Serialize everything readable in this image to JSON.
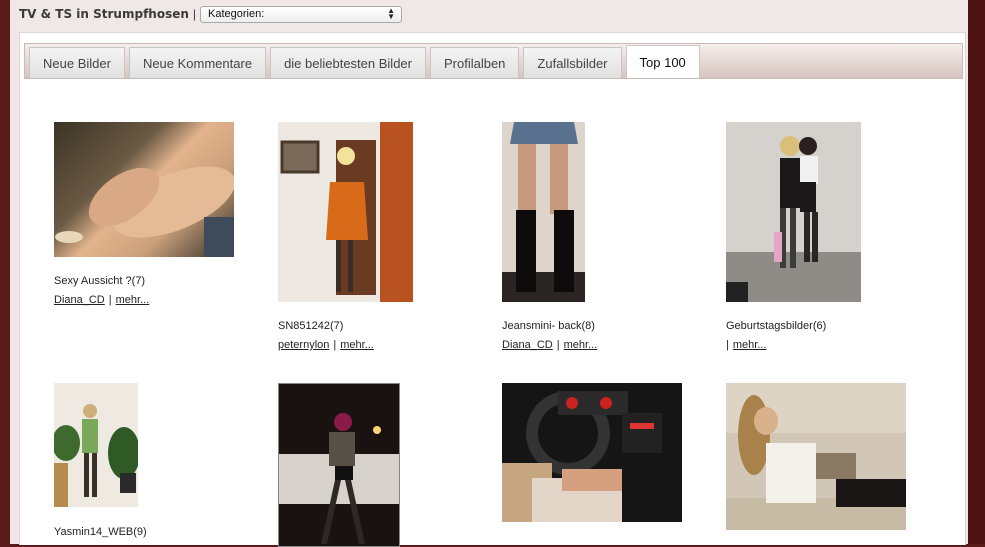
{
  "header": {
    "site_title": "TV & TS in Strumpfhosen",
    "separator": "|",
    "category_select": "Kategorien:"
  },
  "tabs": [
    {
      "label": "Neue Bilder"
    },
    {
      "label": "Neue Kommentare"
    },
    {
      "label": "die beliebtesten Bilder"
    },
    {
      "label": "Profilalben"
    },
    {
      "label": "Zufallsbilder"
    },
    {
      "label": "Top 100",
      "active": true
    }
  ],
  "items": [
    {
      "title": "Sexy Aussicht ?(7)",
      "user": "Diana_CD",
      "more": "mehr..."
    },
    {
      "title": "SN851242(7)",
      "user": "peternylon",
      "more": "mehr..."
    },
    {
      "title": "Jeansmini- back(8)",
      "user": "Diana_CD",
      "more": "mehr..."
    },
    {
      "title": "Geburtstagsbilder(6)",
      "user": "",
      "more": "mehr..."
    },
    {
      "title": "Yasmin14_WEB(9)",
      "user": "",
      "more": ""
    },
    {
      "title": "",
      "user": "",
      "more": ""
    },
    {
      "title": "",
      "user": "",
      "more": ""
    },
    {
      "title": "",
      "user": "",
      "more": ""
    }
  ]
}
